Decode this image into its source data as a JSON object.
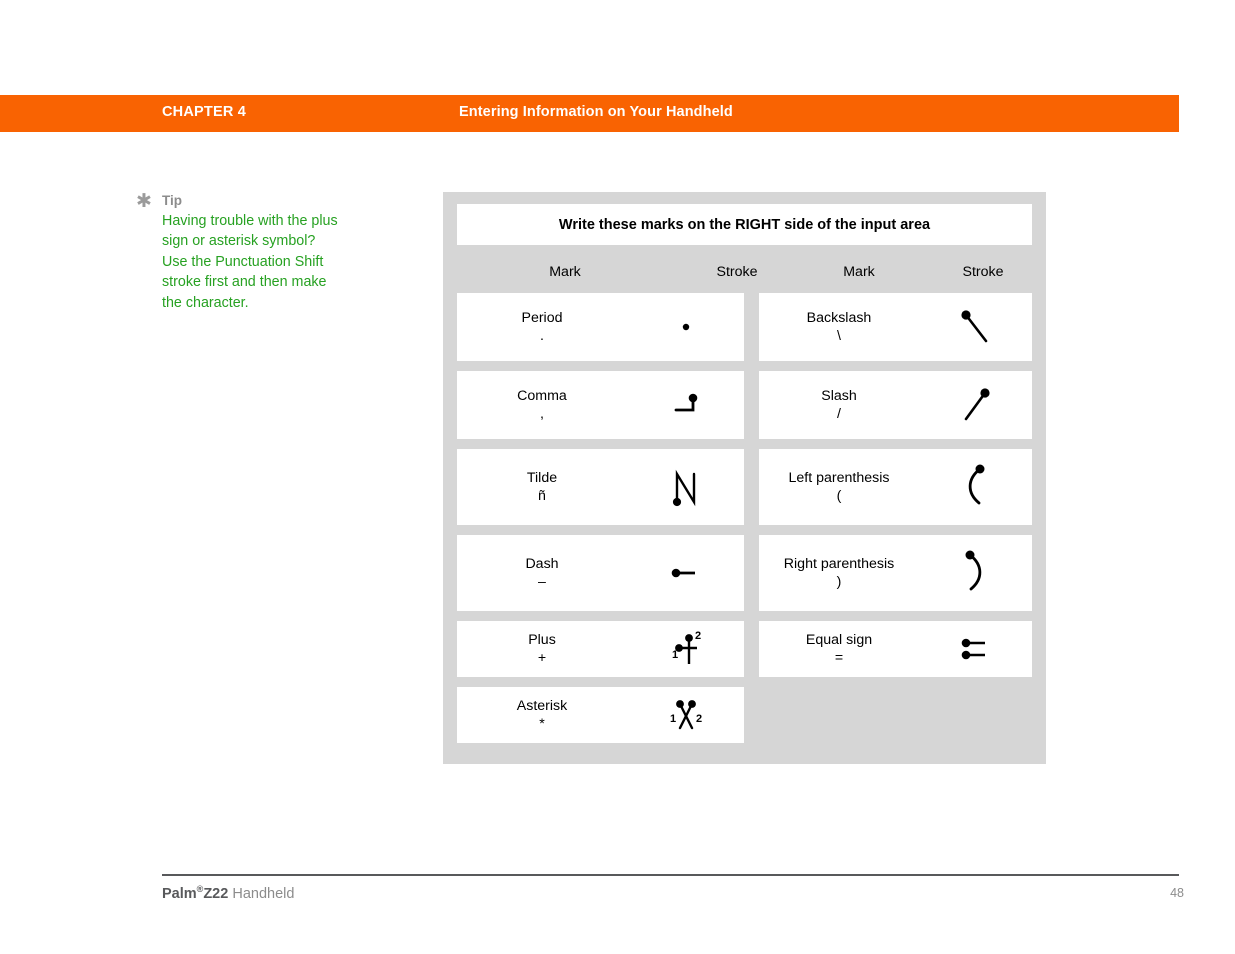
{
  "header": {
    "chapter": "CHAPTER 4",
    "title": "Entering Information on Your Handheld",
    "band_color": "#F96302"
  },
  "tip": {
    "icon": "asterisk-icon",
    "label": "Tip",
    "text": "Having trouble with the plus sign or asterisk symbol? Use the Punctuation Shift stroke first and then make the character.",
    "text_color": "#27A122",
    "label_color": "#8c8c8c"
  },
  "table": {
    "title": "Write these marks on the RIGHT side of the input area",
    "column_headers": [
      "Mark",
      "Stroke",
      "Mark",
      "Stroke"
    ],
    "panel_bg": "#D6D6D6",
    "rows": [
      {
        "left": {
          "name": "Period",
          "symbol": ".",
          "stroke": "dot-stroke"
        },
        "right": {
          "name": "Backslash",
          "symbol": "\\",
          "stroke": "backslash-stroke"
        }
      },
      {
        "left": {
          "name": "Comma",
          "symbol": ",",
          "stroke": "comma-stroke"
        },
        "right": {
          "name": "Slash",
          "symbol": "/",
          "stroke": "slash-stroke"
        }
      },
      {
        "left": {
          "name": "Tilde",
          "symbol": "ñ",
          "stroke": "tilde-stroke"
        },
        "right": {
          "name": "Left parenthesis",
          "symbol": "(",
          "stroke": "left-paren-stroke"
        }
      },
      {
        "left": {
          "name": "Dash",
          "symbol": "–",
          "stroke": "dash-stroke"
        },
        "right": {
          "name": "Right parenthesis",
          "symbol": ")",
          "stroke": "right-paren-stroke"
        }
      },
      {
        "left": {
          "name": "Plus",
          "symbol": "+",
          "stroke": "plus-stroke",
          "stroke_order": [
            "1",
            "2"
          ]
        },
        "right": {
          "name": "Equal sign",
          "symbol": "=",
          "stroke": "equals-stroke"
        }
      },
      {
        "left": {
          "name": "Asterisk",
          "symbol": "*",
          "stroke": "asterisk-stroke",
          "stroke_order": [
            "1",
            "2"
          ]
        },
        "right": null
      }
    ]
  },
  "footer": {
    "brand": "Palm",
    "brand_sup": "®",
    "model": "Z22",
    "product": "Handheld",
    "page_number": "48"
  }
}
